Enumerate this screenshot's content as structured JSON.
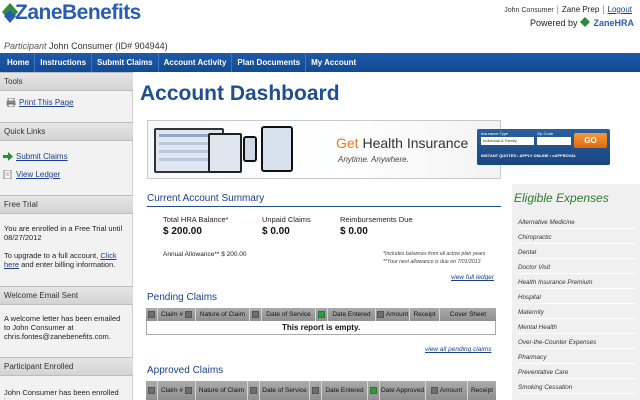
{
  "brand": {
    "logo_text": "ZaneBenefits",
    "powered_by": "Powered by",
    "powered_brand": "ZaneHRA"
  },
  "top_links": {
    "user": "John Consumer",
    "company": "Zane Prep",
    "logout": "Logout"
  },
  "participant": {
    "label": "Participant",
    "value": "John Consumer (ID# 904944)"
  },
  "nav": [
    "Home",
    "Instructions",
    "Submit Claims",
    "Account Activity",
    "Plan Documents",
    "My Account"
  ],
  "sidebar": {
    "tools_title": "Tools",
    "print_label": "Print This Page",
    "quick_links_title": "Quick Links",
    "quick_links": [
      "Submit Claims",
      "View Ledger"
    ],
    "free_trial_title": "Free Trial",
    "free_trial_text": "You are enrolled in a Free Trial until 08/27/2012",
    "upgrade_pre": "To upgrade to a full account,",
    "upgrade_link": "Click here",
    "upgrade_post": "and enter billing information.",
    "welcome_title": "Welcome Email Sent",
    "welcome_text": "A welcome letter has been emailed to John Consumer at chris.fontes@zanebenefits.com.",
    "enrolled_title": "Participant Enrolled",
    "enrolled_text": "John Consumer has been enrolled in"
  },
  "main": {
    "title": "Account Dashboard",
    "banner": {
      "get": "Get",
      "health": "Health Insurance",
      "tagline": "Anytime.  Anywhere.",
      "insurance_type_label": "Insurance Type",
      "zip_label": "Zip Code",
      "insurance_type_value": "Individual & Family",
      "go": "GO",
      "instant_quotes": "INSTANT QUOTES  •  APPLY ONLINE  •  eAPPROVAL"
    },
    "summary": {
      "title": "Current Account Summary",
      "hra_balance_label": "Total HRA Balance*",
      "hra_balance_value": "$ 200.00",
      "unpaid_label": "Unpaid Claims",
      "unpaid_value": "$ 0.00",
      "reimb_label": "Reimbursements Due",
      "reimb_value": "$ 0.00",
      "annual_label": "Annual Allowance**",
      "annual_value": "$ 200.00",
      "note1": "*Includes balances from all active plan years",
      "note2": "**Your next allowance is due on 7/01/2013",
      "view_ledger": "view full ledger"
    },
    "pending": {
      "title": "Pending Claims",
      "columns": [
        "Claim #",
        "Nature of Claim",
        "Date of Service",
        "Date Entered",
        "Amount",
        "Receipt",
        "Cover Sheet"
      ],
      "empty": "This report is empty.",
      "view_all": "view all pending claims"
    },
    "approved": {
      "title": "Approved Claims",
      "columns": [
        "Claim #",
        "Nature of Claim",
        "Date of Service",
        "Date Entered",
        "Date Approved",
        "Amount",
        "Receipt"
      ]
    }
  },
  "eligible": {
    "title": "Eligible Expenses",
    "items": [
      "Alternative Medicine",
      "Chiropractic",
      "Dental",
      "Doctor Visit",
      "Health Insurance Premium",
      "Hospital",
      "Maternity",
      "Mental Health",
      "Over-the-Counter Expenses",
      "Pharmacy",
      "Preventative Care",
      "Smoking Cessation"
    ]
  },
  "colors": {
    "nav": "#1a4f9a",
    "title": "#1f4f8f",
    "accent_orange": "#e87722",
    "eligible_green": "#2e7a2e"
  }
}
